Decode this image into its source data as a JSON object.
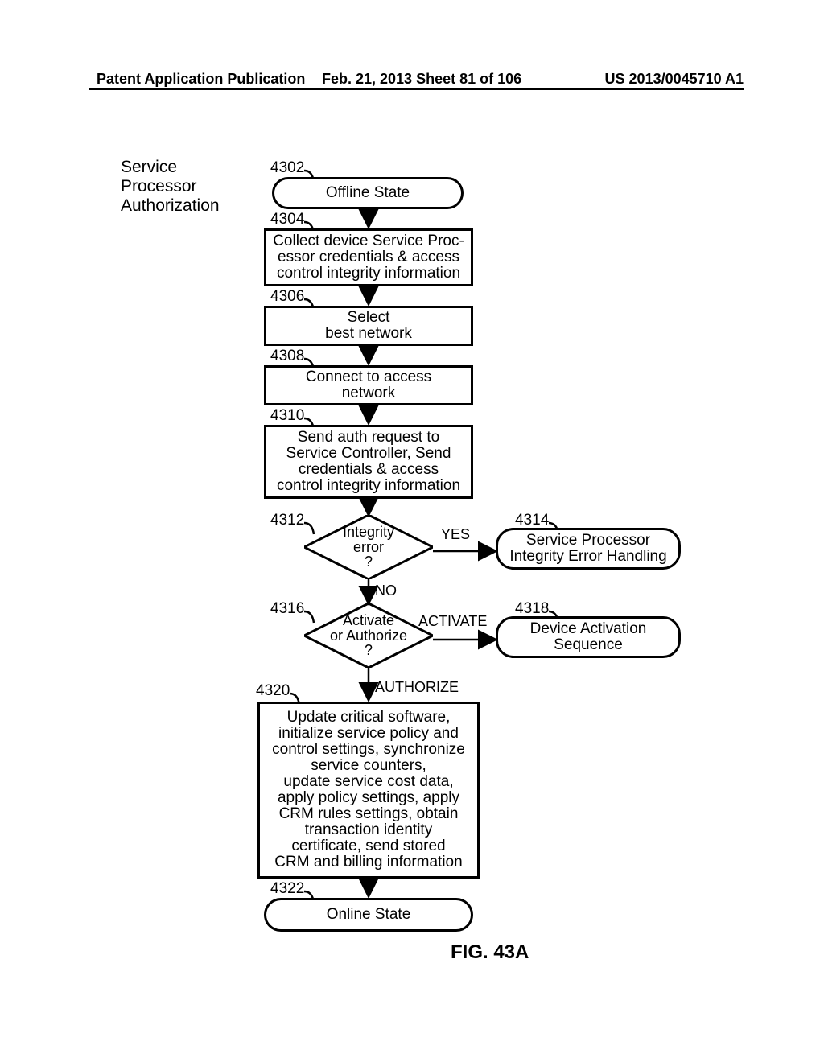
{
  "header": {
    "left": "Patent Application Publication",
    "center": "Feb. 21, 2013  Sheet 81 of 106",
    "right": "US 2013/0045710 A1"
  },
  "title_lines": [
    "Service",
    "Processor",
    "Authorization"
  ],
  "figure_label": "FIG. 43A",
  "chart_data": {
    "type": "flowchart",
    "nodes": [
      {
        "id": "4302",
        "ref": "4302",
        "kind": "terminal",
        "text": "Offline State"
      },
      {
        "id": "4304",
        "ref": "4304",
        "kind": "process",
        "text": "Collect device Service Processor credentials & access control integrity information"
      },
      {
        "id": "4306",
        "ref": "4306",
        "kind": "process",
        "text": "Select best network"
      },
      {
        "id": "4308",
        "ref": "4308",
        "kind": "process",
        "text": "Connect to access network"
      },
      {
        "id": "4310",
        "ref": "4310",
        "kind": "process",
        "text": "Send auth request to Service Controller, Send credentials & access control integrity information"
      },
      {
        "id": "4312",
        "ref": "4312",
        "kind": "decision",
        "text": "Integrity error ?"
      },
      {
        "id": "4314",
        "ref": "4314",
        "kind": "terminal",
        "text": "Service Processor Integrity Error Handling"
      },
      {
        "id": "4316",
        "ref": "4316",
        "kind": "decision",
        "text": "Activate or Authorize ?"
      },
      {
        "id": "4318",
        "ref": "4318",
        "kind": "terminal",
        "text": "Device Activation Sequence"
      },
      {
        "id": "4320",
        "ref": "4320",
        "kind": "process",
        "text": "Update critical software, initialize service policy and control settings, synchronize service counters, update service cost data, apply policy settings, apply CRM rules settings, obtain transaction identity certificate, send stored CRM and billing information"
      },
      {
        "id": "4322",
        "ref": "4322",
        "kind": "terminal",
        "text": "Online State"
      }
    ],
    "edges": [
      {
        "from": "4302",
        "to": "4304",
        "label": ""
      },
      {
        "from": "4304",
        "to": "4306",
        "label": ""
      },
      {
        "from": "4306",
        "to": "4308",
        "label": ""
      },
      {
        "from": "4308",
        "to": "4310",
        "label": ""
      },
      {
        "from": "4310",
        "to": "4312",
        "label": ""
      },
      {
        "from": "4312",
        "to": "4314",
        "label": "YES"
      },
      {
        "from": "4312",
        "to": "4316",
        "label": "NO"
      },
      {
        "from": "4316",
        "to": "4318",
        "label": "ACTIVATE"
      },
      {
        "from": "4316",
        "to": "4320",
        "label": "AUTHORIZE"
      },
      {
        "from": "4320",
        "to": "4322",
        "label": ""
      }
    ],
    "ref_labels": {
      "4302": "4302",
      "4304": "4304",
      "4306": "4306",
      "4308": "4308",
      "4310": "4310",
      "4312": "4312",
      "4314": "4314",
      "4316": "4316",
      "4318": "4318",
      "4320": "4320",
      "4322": "4322"
    },
    "edge_text": {
      "YES": "YES",
      "NO": "NO",
      "ACTIVATE": "ACTIVATE",
      "AUTHORIZE": "AUTHORIZE"
    }
  },
  "node_text": {
    "4302": "Offline State",
    "4304_l1": "Collect device Service Proc-",
    "4304_l2": "essor credentials & access",
    "4304_l3": "control integrity information",
    "4306_l1": "Select",
    "4306_l2": "best network",
    "4308_l1": "Connect to access",
    "4308_l2": "network",
    "4310_l1": "Send auth request to",
    "4310_l2": "Service Controller, Send",
    "4310_l3": "credentials &  access",
    "4310_l4": "control integrity information",
    "4312_l1": "Integrity",
    "4312_l2": "error",
    "4312_l3": "?",
    "4314_l1": "Service Processor",
    "4314_l2": "Integrity Error Handling",
    "4316_l1": "Activate",
    "4316_l2": "or Authorize",
    "4316_l3": "?",
    "4318_l1": "Device Activation",
    "4318_l2": "Sequence",
    "4320_l1": "Update critical software,",
    "4320_l2": "initialize service policy and",
    "4320_l3": "control settings, synchronize",
    "4320_l4": "service counters,",
    "4320_l5": "update service cost data,",
    "4320_l6": "apply policy settings, apply",
    "4320_l7": "CRM rules settings, obtain",
    "4320_l8": "transaction identity",
    "4320_l9": "certificate, send stored",
    "4320_l10": "CRM and billing information",
    "4322": "Online State"
  }
}
